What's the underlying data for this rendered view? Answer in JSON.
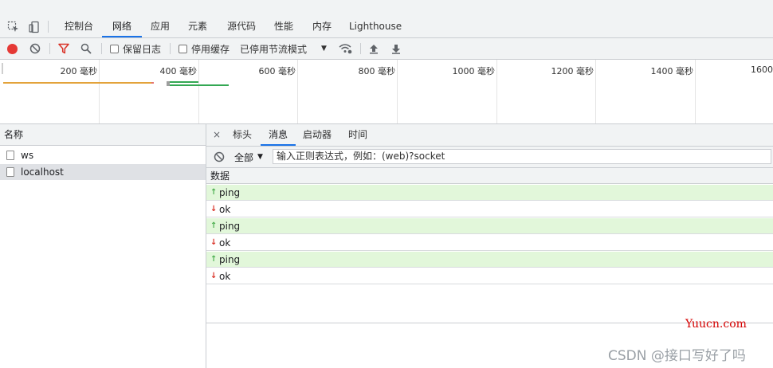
{
  "main_tabs": [
    {
      "label": "控制台",
      "active": false
    },
    {
      "label": "网络",
      "active": true
    },
    {
      "label": "应用",
      "active": false
    },
    {
      "label": "元素",
      "active": false
    },
    {
      "label": "源代码",
      "active": false
    },
    {
      "label": "性能",
      "active": false
    },
    {
      "label": "内存",
      "active": false
    },
    {
      "label": "Lighthouse",
      "active": false
    }
  ],
  "toolbar": {
    "preserve_log_label": "保留日志",
    "disable_cache_label": "停用缓存",
    "throttling_value": "已停用节流模式",
    "record_color": "#e53935",
    "filter_icon_color": "#d93025"
  },
  "timeline": {
    "ticks": [
      "200 毫秒",
      "400 毫秒",
      "600 毫秒",
      "800 毫秒",
      "1000 毫秒",
      "1200 毫秒",
      "1400 毫秒",
      "1600"
    ]
  },
  "requests": {
    "header": "名称",
    "items": [
      {
        "name": "ws",
        "selected": false
      },
      {
        "name": "localhost",
        "selected": true
      }
    ]
  },
  "detail": {
    "close_label": "×",
    "tabs": [
      {
        "label": "标头",
        "active": false
      },
      {
        "label": "消息",
        "active": true
      },
      {
        "label": "启动器",
        "active": false
      },
      {
        "label": "时间",
        "active": false
      }
    ],
    "filter_type": "全部",
    "filter_placeholder": "输入正则表达式，例如：(web)?socket",
    "data_header": "数据",
    "messages": [
      {
        "direction": "sent",
        "text": "ping"
      },
      {
        "direction": "received",
        "text": "ok"
      },
      {
        "direction": "sent",
        "text": "ping"
      },
      {
        "direction": "received",
        "text": "ok"
      },
      {
        "direction": "sent",
        "text": "ping"
      },
      {
        "direction": "received",
        "text": "ok"
      }
    ]
  },
  "watermarks": {
    "site": "Yuucn.com",
    "csdn": "CSDN @接口写好了吗"
  }
}
